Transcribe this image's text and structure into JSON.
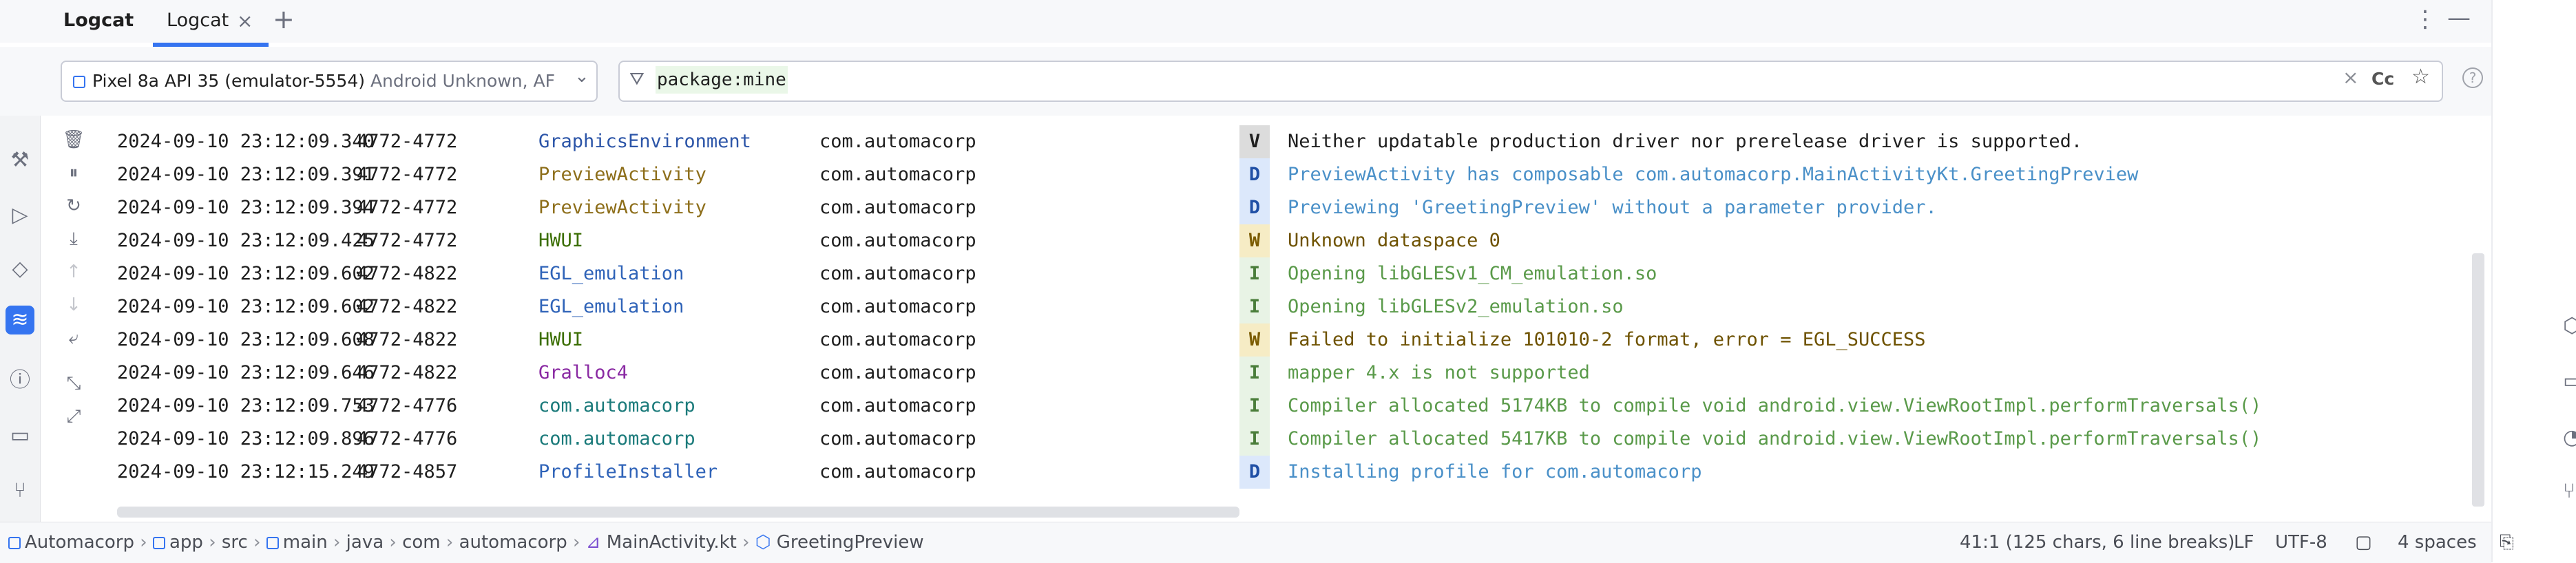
{
  "window": {
    "title": "Logcat",
    "tabs": [
      {
        "label": "Logcat",
        "active": true
      }
    ],
    "close_glyph": "×",
    "add_glyph": "+",
    "menu_glyph": "⋮",
    "minimize_glyph": "—"
  },
  "filters": {
    "device_name": "Pixel 8a API 35 (emulator-5554)",
    "device_detail": "Android Unknown, AF",
    "filter_query": "package:mine",
    "case_toggle": "Cc"
  },
  "level_colors": {
    "V": {
      "bg": "#dcdcdc",
      "fg": "#1f1f1f"
    },
    "D": {
      "bg": "#dce8fb",
      "fg": "#1f4fa5"
    },
    "I": {
      "bg": "#e8f3e5",
      "fg": "#4a7d3a"
    },
    "W": {
      "bg": "#f6ecc5",
      "fg": "#7a5b00"
    }
  },
  "tag_colors": {
    "GraphicsEnvironment": "#2c55a8",
    "PreviewActivity": "#8d6e1a",
    "HWUI": "#3a6d00",
    "EGL_emulation": "#2f63b8",
    "Gralloc4": "#8a2aa3",
    "com.automacorp": "#1a7a7a",
    "ProfileInstaller": "#2f63b8"
  },
  "message_colors": {
    "V": "#1f1f1f",
    "D": "#4a90c8",
    "I": "#5a9a4a",
    "W": "#6e5200"
  },
  "log": [
    {
      "ts": "2024-09-10 23:12:09.340",
      "pid": "4772-4772",
      "tag": "GraphicsEnvironment",
      "pkg": "com.automacorp",
      "level": "V",
      "msg": "Neither updatable production driver nor prerelease driver is supported."
    },
    {
      "ts": "2024-09-10 23:12:09.391",
      "pid": "4772-4772",
      "tag": "PreviewActivity",
      "pkg": "com.automacorp",
      "level": "D",
      "msg": "PreviewActivity has composable com.automacorp.MainActivityKt.GreetingPreview"
    },
    {
      "ts": "2024-09-10 23:12:09.394",
      "pid": "4772-4772",
      "tag": "PreviewActivity",
      "pkg": "com.automacorp",
      "level": "D",
      "msg": "Previewing 'GreetingPreview' without a parameter provider."
    },
    {
      "ts": "2024-09-10 23:12:09.425",
      "pid": "4772-4772",
      "tag": "HWUI",
      "pkg": "com.automacorp",
      "level": "W",
      "msg": "Unknown dataspace 0"
    },
    {
      "ts": "2024-09-10 23:12:09.602",
      "pid": "4772-4822",
      "tag": "EGL_emulation",
      "pkg": "com.automacorp",
      "level": "I",
      "msg": "Opening libGLESv1_CM_emulation.so"
    },
    {
      "ts": "2024-09-10 23:12:09.602",
      "pid": "4772-4822",
      "tag": "EGL_emulation",
      "pkg": "com.automacorp",
      "level": "I",
      "msg": "Opening libGLESv2_emulation.so"
    },
    {
      "ts": "2024-09-10 23:12:09.608",
      "pid": "4772-4822",
      "tag": "HWUI",
      "pkg": "com.automacorp",
      "level": "W",
      "msg": "Failed to initialize 101010-2 format, error = EGL_SUCCESS"
    },
    {
      "ts": "2024-09-10 23:12:09.646",
      "pid": "4772-4822",
      "tag": "Gralloc4",
      "pkg": "com.automacorp",
      "level": "I",
      "msg": "mapper 4.x is not supported"
    },
    {
      "ts": "2024-09-10 23:12:09.753",
      "pid": "4772-4776",
      "tag": "com.automacorp",
      "pkg": "com.automacorp",
      "level": "I",
      "msg": "Compiler allocated 5174KB to compile void android.view.ViewRootImpl.performTraversals()"
    },
    {
      "ts": "2024-09-10 23:12:09.896",
      "pid": "4772-4776",
      "tag": "com.automacorp",
      "pkg": "com.automacorp",
      "level": "I",
      "msg": "Compiler allocated 5417KB to compile void android.view.ViewRootImpl.performTraversals()"
    },
    {
      "ts": "2024-09-10 23:12:15.249",
      "pid": "4772-4857",
      "tag": "ProfileInstaller",
      "pkg": "com.automacorp",
      "level": "D",
      "msg": "Installing profile for com.automacorp"
    }
  ],
  "left_tools": [
    "hammer-icon",
    "run-icon",
    "gem-icon",
    "logcat-icon",
    "problems-icon",
    "terminal-icon",
    "git-icon"
  ],
  "log_tools": [
    "trash-icon",
    "pause-icon",
    "restart-icon",
    "scroll-to-end-icon",
    "up-arrow-icon",
    "down-arrow-icon",
    "wrap-icon",
    "collapse-icon",
    "expand-icon"
  ],
  "breadcrumbs": [
    "Automacorp",
    "app",
    "src",
    "main",
    "java",
    "com",
    "automacorp",
    "MainActivity.kt",
    "GreetingPreview"
  ],
  "status": {
    "position": "41:1 (125 chars, 6 line breaks)",
    "line_ending": "LF",
    "encoding": "UTF-8",
    "indent": "4 spaces"
  }
}
